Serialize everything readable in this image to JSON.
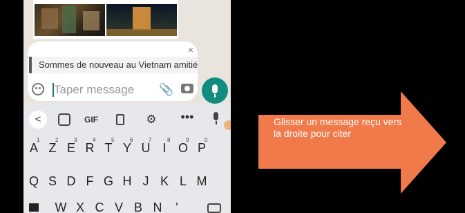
{
  "composer": {
    "quoted_message": "Sommes de nouveau au Vietnam amitié",
    "close": "×",
    "placeholder": "Taper message"
  },
  "keyboard": {
    "toolbar": {
      "back": "<",
      "gif": "GIF",
      "gear": "⚙",
      "more": "•••"
    },
    "row1": [
      {
        "key": "A",
        "sup": "1"
      },
      {
        "key": "Z",
        "sup": "2"
      },
      {
        "key": "E",
        "sup": "3"
      },
      {
        "key": "R",
        "sup": "4"
      },
      {
        "key": "T",
        "sup": "5"
      },
      {
        "key": "Y",
        "sup": "6"
      },
      {
        "key": "U",
        "sup": "7"
      },
      {
        "key": "I",
        "sup": "8"
      },
      {
        "key": "O",
        "sup": "9"
      },
      {
        "key": "P",
        "sup": "0"
      }
    ],
    "row2": [
      "Q",
      "S",
      "D",
      "F",
      "G",
      "H",
      "J",
      "K",
      "L",
      "M"
    ],
    "row3": [
      "W",
      "X",
      "C",
      "V",
      "B",
      "N",
      "'"
    ]
  },
  "callout": {
    "text": "Glisser un message reçu vers la droite pour citer",
    "color": "#f07a4a"
  },
  "colors": {
    "accent": "#128c7e",
    "background": "#000000"
  }
}
